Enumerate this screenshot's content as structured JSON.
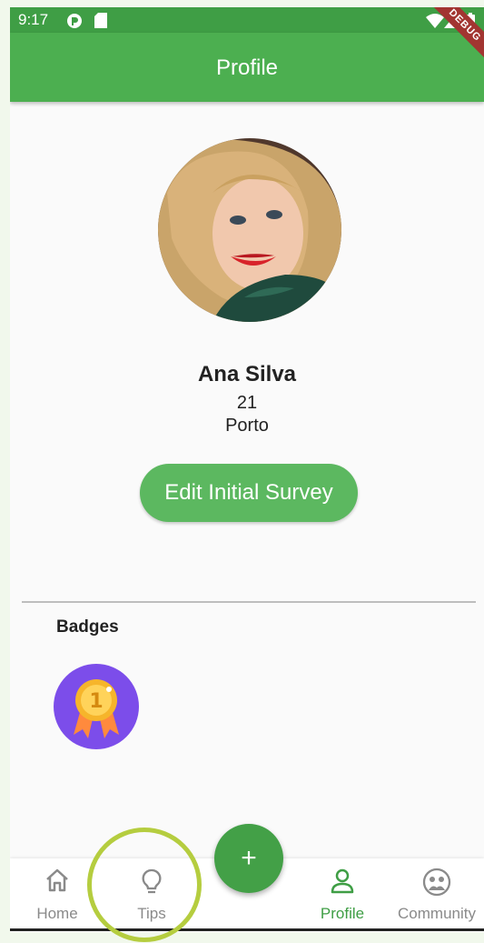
{
  "status_bar": {
    "time": "9:17",
    "debug_label": "DEBUG"
  },
  "app_bar": {
    "title": "Profile"
  },
  "profile": {
    "name": "Ana Silva",
    "age": "21",
    "city": "Porto"
  },
  "actions": {
    "edit_survey_label": "Edit Initial Survey"
  },
  "badges": {
    "title": "Badges",
    "items": [
      {
        "icon": "first-place-medal-icon"
      }
    ]
  },
  "fab": {
    "label": "+"
  },
  "bottom_nav": {
    "items": [
      {
        "label": "Home",
        "icon": "home-icon",
        "active": false
      },
      {
        "label": "Tips",
        "icon": "lightbulb-icon",
        "active": false
      },
      {
        "label": "Profile",
        "icon": "person-icon",
        "active": true
      },
      {
        "label": "Community",
        "icon": "community-icon",
        "active": false
      }
    ]
  },
  "colors": {
    "primary": "#4caf50",
    "status_bar": "#3f9e45",
    "button": "#5cb860",
    "badge_bg": "#7c4dea",
    "active_nav": "#3f9e45",
    "highlight_ring": "#b5cd3f"
  }
}
